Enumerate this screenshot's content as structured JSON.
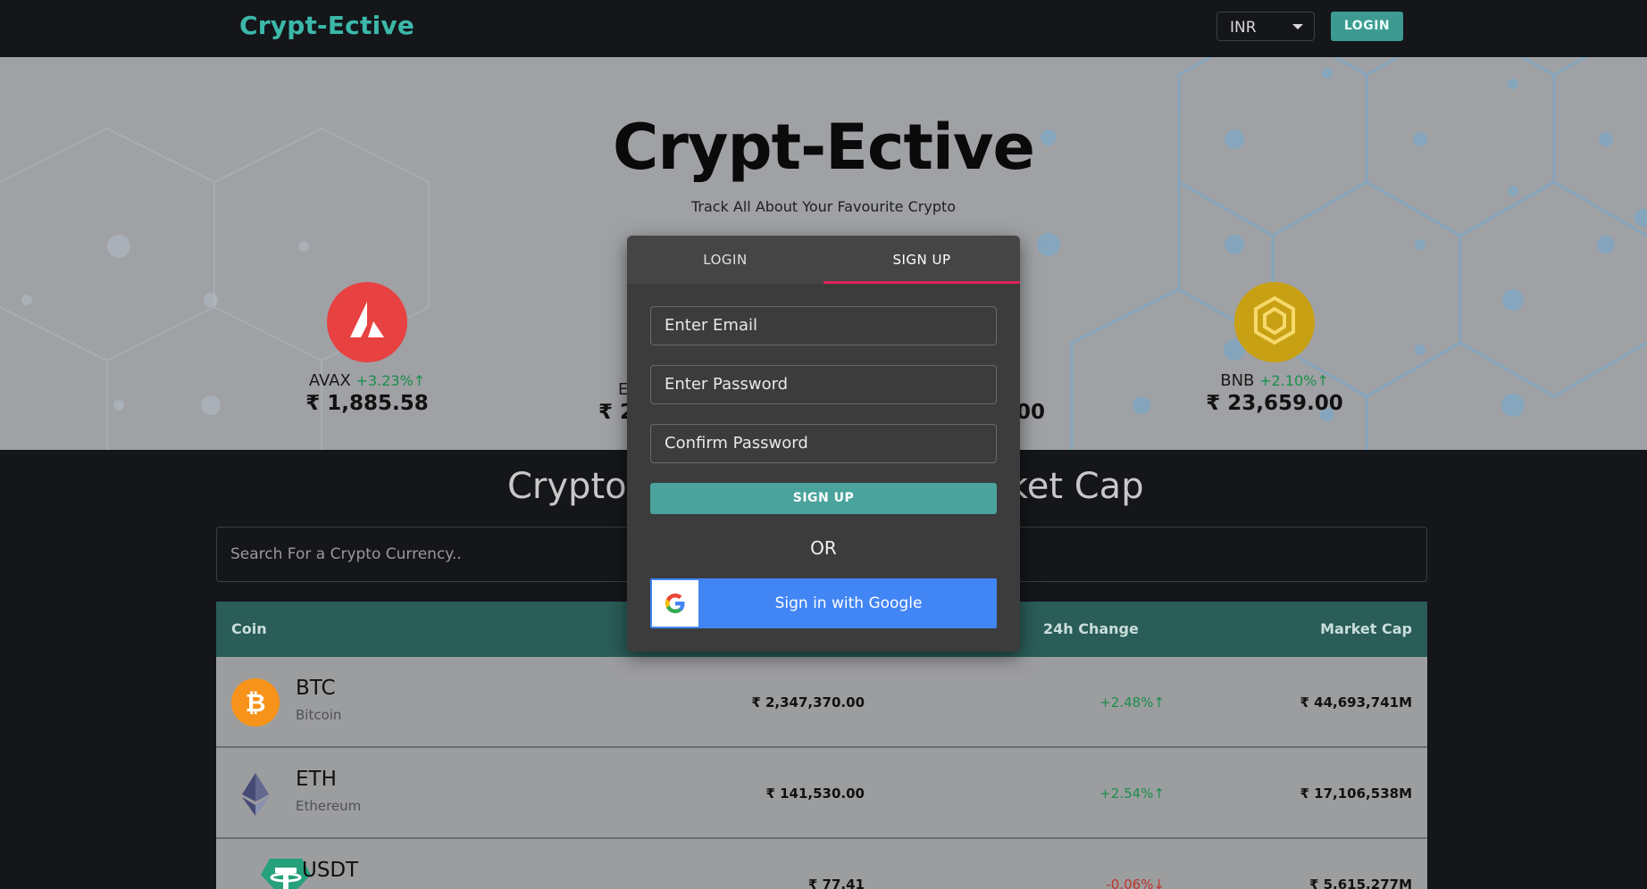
{
  "header": {
    "brand": "Crypt-Ective",
    "currency": "INR",
    "login_label": "LOGIN"
  },
  "banner": {
    "title": "Crypt-Ective",
    "subtitle": "Track All About Your Favourite Crypto",
    "coins": [
      {
        "symbol": "AVAX",
        "change": "+3.23%",
        "price": "₹ 1,885.58",
        "color": "#e84142"
      },
      {
        "symbol": "E",
        "change": "",
        "price": "₹ 2",
        "color": ""
      },
      {
        "symbol": "",
        "change": "",
        "price": "00",
        "color": ""
      },
      {
        "symbol": "BNB",
        "change": "+2.10%",
        "price": "₹ 23,659.00",
        "color": "#f0b90b"
      }
    ]
  },
  "section": {
    "title_left": "Cryptoc",
    "title_right": "ket Cap",
    "search_placeholder": "Search For a Crypto Currency.."
  },
  "table": {
    "headers": {
      "coin": "Coin",
      "change": "24h Change",
      "market_cap": "Market Cap"
    },
    "rows": [
      {
        "symbol": "BTC",
        "name": "Bitcoin",
        "price": "₹ 2,347,370.00",
        "change": "+2.48%",
        "market_cap": "₹ 44,693,741M",
        "direction": "up"
      },
      {
        "symbol": "ETH",
        "name": "Ethereum",
        "price": "₹ 141,530.00",
        "change": "+2.54%",
        "market_cap": "₹ 17,106,538M",
        "direction": "up"
      },
      {
        "symbol": "USDT",
        "name": "",
        "price": "₹ 77.41",
        "change": "-0.06%",
        "market_cap": "₹ 5,615,277M",
        "direction": "down"
      }
    ]
  },
  "modal": {
    "tab_login": "LOGIN",
    "tab_signup": "SIGN UP",
    "email_placeholder": "Enter Email",
    "password_placeholder": "Enter Password",
    "confirm_placeholder": "Confirm Password",
    "signup_button": "SIGN UP",
    "or_text": "OR",
    "google_button": "Sign in with Google"
  },
  "colors": {
    "accent": "#3cb8aa",
    "tab_indicator": "#e0245e",
    "google_blue": "#4285f4",
    "positive": "#1b8f4c",
    "negative": "#c0352b"
  }
}
